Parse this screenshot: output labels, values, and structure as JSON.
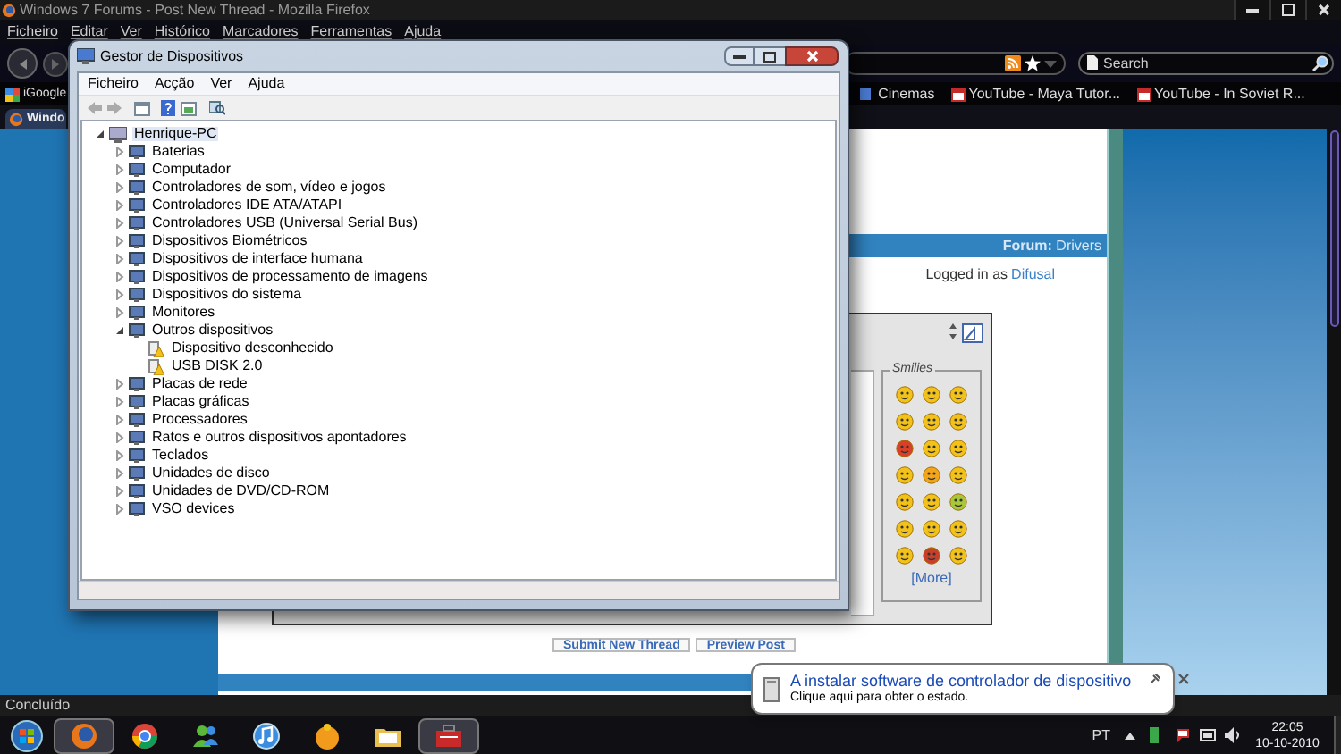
{
  "firefox": {
    "title": "Windows 7 Forums - Post New Thread - Mozilla Firefox",
    "menu": [
      "Ficheiro",
      "Editar",
      "Ver",
      "Histórico",
      "Marcadores",
      "Ferramentas",
      "Ajuda"
    ],
    "search": {
      "placeholder": "Search"
    },
    "bookmarks_left": [
      "iGoogle"
    ],
    "bookmarks_right": [
      {
        "label": "Cinemas",
        "kind": "site"
      },
      {
        "label": "YouTube - Maya Tutor...",
        "kind": "video"
      },
      {
        "label": "YouTube - In Soviet R...",
        "kind": "video"
      }
    ],
    "tab": "Windo",
    "status": "Concluído"
  },
  "page": {
    "forum": "**Forum:** Drivers",
    "logged_in": "Logged in as",
    "user": "Difusal",
    "smilies_title": "Smilies",
    "smilies": [
      {
        "color": "#f2c21b"
      },
      {
        "color": "#f2c21b"
      },
      {
        "color": "#f2c21b"
      },
      {
        "color": "#f2c21b"
      },
      {
        "color": "#f2c21b"
      },
      {
        "color": "#f2c21b"
      },
      {
        "color": "#d9402a"
      },
      {
        "color": "#f2c21b"
      },
      {
        "color": "#f2c21b"
      },
      {
        "color": "#f2c21b"
      },
      {
        "color": "#f2a51b"
      },
      {
        "color": "#f2c21b"
      },
      {
        "color": "#f2c21b"
      },
      {
        "color": "#f2c21b"
      },
      {
        "color": "#a8c83a"
      },
      {
        "color": "#f2c21b"
      },
      {
        "color": "#f2c21b"
      },
      {
        "color": "#f2c21b"
      },
      {
        "color": "#f2c21b"
      },
      {
        "color": "#c8402a"
      },
      {
        "color": "#f2c21b"
      }
    ],
    "more": "[More]",
    "buttons": [
      "Submit New Thread",
      "Preview Post"
    ]
  },
  "device_manager": {
    "title": "Gestor de Dispositivos",
    "menu": [
      "Ficheiro",
      "Acção",
      "Ver",
      "Ajuda"
    ],
    "tree": {
      "label": "Henrique-PC",
      "kind": "computer",
      "selected": true,
      "expanded": true,
      "children": [
        {
          "label": "Baterias",
          "kind": "device",
          "selected": false,
          "expanded": false
        },
        {
          "label": "Computador",
          "kind": "device",
          "selected": false,
          "expanded": false
        },
        {
          "label": "Controladores de som, vídeo e jogos",
          "kind": "device",
          "selected": false,
          "expanded": false
        },
        {
          "label": "Controladores IDE ATA/ATAPI",
          "kind": "device",
          "selected": false,
          "expanded": false
        },
        {
          "label": "Controladores USB (Universal Serial Bus)",
          "kind": "device",
          "selected": false,
          "expanded": false
        },
        {
          "label": "Dispositivos Biométricos",
          "kind": "device",
          "selected": false,
          "expanded": false
        },
        {
          "label": "Dispositivos de interface humana",
          "kind": "device",
          "selected": false,
          "expanded": false
        },
        {
          "label": "Dispositivos de processamento de imagens",
          "kind": "device",
          "selected": false,
          "expanded": false
        },
        {
          "label": "Dispositivos do sistema",
          "kind": "device",
          "selected": false,
          "expanded": false
        },
        {
          "label": "Monitores",
          "kind": "device",
          "selected": false,
          "expanded": false
        },
        {
          "label": "Outros dispositivos",
          "kind": "device",
          "selected": false,
          "expanded": true,
          "children": [
            {
              "label": "Dispositivo desconhecido",
              "kind": "problem",
              "selected": false
            },
            {
              "label": "USB DISK 2.0",
              "kind": "problem",
              "selected": false
            }
          ]
        },
        {
          "label": "Placas de rede",
          "kind": "device",
          "selected": false,
          "expanded": false
        },
        {
          "label": "Placas gráficas",
          "kind": "device",
          "selected": false,
          "expanded": false
        },
        {
          "label": "Processadores",
          "kind": "device",
          "selected": false,
          "expanded": false
        },
        {
          "label": "Ratos e outros dispositivos apontadores",
          "kind": "device",
          "selected": false,
          "expanded": false
        },
        {
          "label": "Teclados",
          "kind": "device",
          "selected": false,
          "expanded": false
        },
        {
          "label": "Unidades de disco",
          "kind": "device",
          "selected": false,
          "expanded": false
        },
        {
          "label": "Unidades de DVD/CD-ROM",
          "kind": "device",
          "selected": false,
          "expanded": false
        },
        {
          "label": "VSO devices",
          "kind": "device",
          "selected": false,
          "expanded": false
        }
      ]
    }
  },
  "notification": {
    "title": "A instalar software de controlador de dispositivo",
    "text": "Clique aqui para obter o estado."
  },
  "taskbar": {
    "apps": [
      {
        "kind": "firefox",
        "highlighted": true
      },
      {
        "kind": "chrome",
        "highlighted": false
      },
      {
        "kind": "messenger",
        "highlighted": false
      },
      {
        "kind": "itunes",
        "highlighted": false
      },
      {
        "kind": "orange",
        "highlighted": false
      },
      {
        "kind": "folder",
        "highlighted": false
      },
      {
        "kind": "toolbox",
        "highlighted": true
      }
    ],
    "language": "PT",
    "time": "22:05",
    "date": "10-10-2010"
  }
}
